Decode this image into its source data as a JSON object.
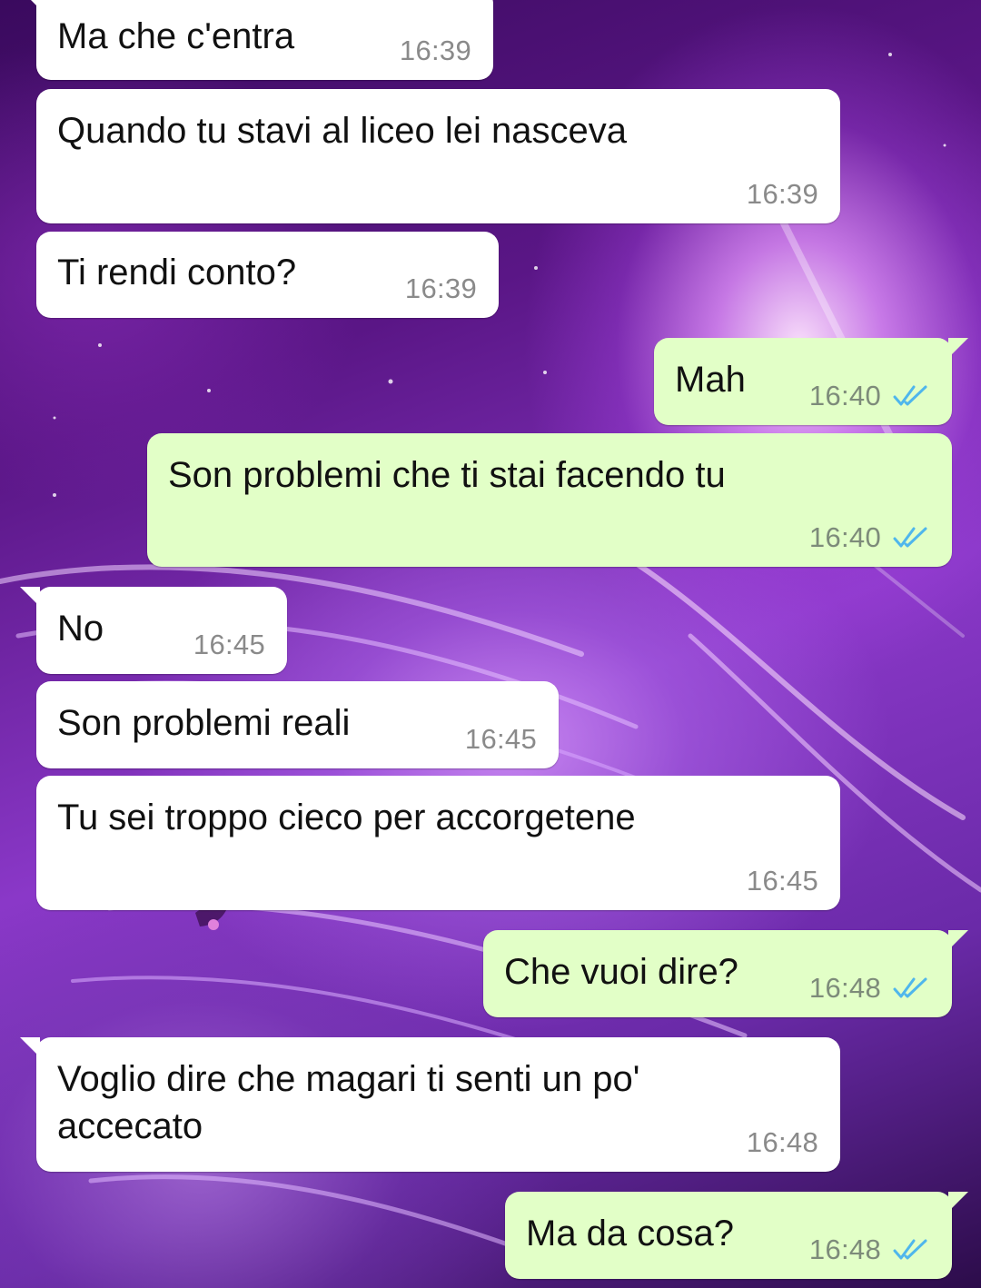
{
  "conversation": {
    "messages": [
      {
        "direction": "in",
        "text": "Ma che c'entra",
        "time": "16:39"
      },
      {
        "direction": "in",
        "text": "Quando tu stavi al liceo lei nasceva",
        "time": "16:39"
      },
      {
        "direction": "in",
        "text": "Ti rendi conto?",
        "time": "16:39"
      },
      {
        "direction": "out",
        "text": "Mah",
        "time": "16:40",
        "status": "read"
      },
      {
        "direction": "out",
        "text": "Son problemi che ti stai facendo tu",
        "time": "16:40",
        "status": "read"
      },
      {
        "direction": "in",
        "text": "No",
        "time": "16:45"
      },
      {
        "direction": "in",
        "text": "Son problemi reali",
        "time": "16:45"
      },
      {
        "direction": "in",
        "text": "Tu sei troppo cieco per accorgetene",
        "time": "16:45"
      },
      {
        "direction": "out",
        "text": "Che vuoi dire?",
        "time": "16:48",
        "status": "read"
      },
      {
        "direction": "in",
        "text": "Voglio dire che magari ti senti un po'\naccecato",
        "time": "16:48"
      },
      {
        "direction": "out",
        "text": "Ma da cosa?",
        "time": "16:48",
        "status": "read"
      }
    ]
  },
  "colors": {
    "incoming_bubble": "#ffffff",
    "outgoing_bubble": "#e2ffc7",
    "read_ticks": "#4fb6ec",
    "background_accent": "#8a38c8"
  },
  "icons": {
    "read_status": "double-check-icon"
  }
}
